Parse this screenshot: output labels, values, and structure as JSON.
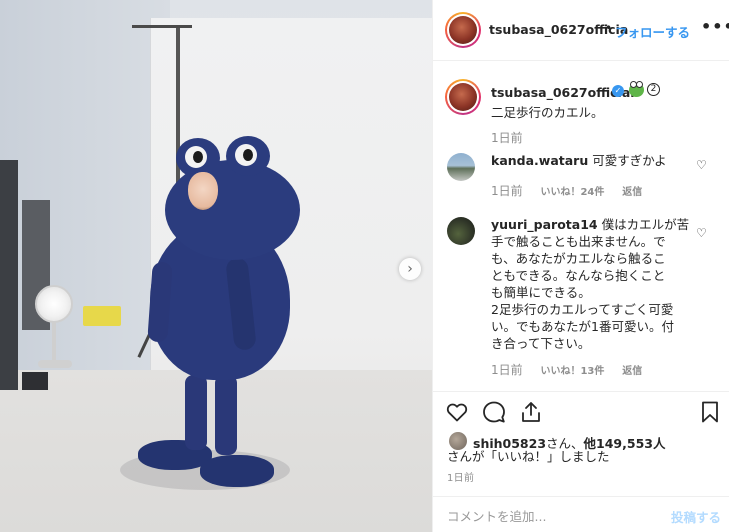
{
  "header": {
    "username": "tsubasa_0627officia",
    "dot": "•",
    "follow_label": "フォローする",
    "more_icon": "more-horizontal-icon"
  },
  "caption": {
    "username": "tsubasa_0627official",
    "verified_icon": "verified-badge-icon",
    "emoji": "frog-emoji",
    "circled_number": "②",
    "text": "二足歩行のカエル。",
    "time": "1日前"
  },
  "comments": [
    {
      "username": "kanda.wataru",
      "text": "可愛すぎかよ",
      "time": "1日前",
      "likes": "いいね！24件",
      "reply": "返信"
    },
    {
      "username": "yuuri_parota14",
      "lines": [
        "僕はカエルが苦",
        "手で触ることも出来ません。で",
        "も、あなたがカエルなら触るこ",
        "ともできる。なんなら抱くこと",
        "も簡単にできる。",
        "2足歩行のカエルってすごく可愛",
        "い。でもあなたが1番可愛い。付",
        "き合って下さい。"
      ],
      "time": "1日前",
      "likes": "いいね！13件",
      "reply": "返信"
    }
  ],
  "actions": {
    "like_icon": "heart-icon",
    "comment_icon": "comment-icon",
    "share_icon": "share-icon",
    "save_icon": "bookmark-icon"
  },
  "likes": {
    "line1_user": "shih05823",
    "line1_mid": "さん、",
    "line1_others": "他149,553人",
    "line2": "さんが「いいね！」しました",
    "time": "1日前"
  },
  "add_comment": {
    "placeholder": "コメントを追加...",
    "post_label": "投稿する"
  },
  "photo": {
    "next_icon": "chevron-right-icon",
    "next_glyph": "›"
  },
  "colors": {
    "link": "#3897f0",
    "post_disabled": "#b3dbff",
    "frog_blue": "#2a3a7c",
    "meta_gray": "#8e8e8e"
  }
}
